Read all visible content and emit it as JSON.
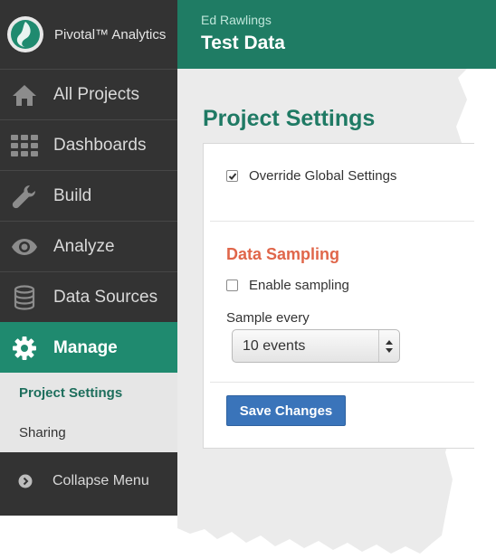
{
  "app": {
    "brand": "Pivotal™ Analytics"
  },
  "sidebar": {
    "items": [
      {
        "label": "All Projects",
        "icon": "home-icon"
      },
      {
        "label": "Dashboards",
        "icon": "grid-icon"
      },
      {
        "label": "Build",
        "icon": "wrench-icon"
      },
      {
        "label": "Analyze",
        "icon": "eye-icon"
      },
      {
        "label": "Data Sources",
        "icon": "database-icon"
      },
      {
        "label": "Manage",
        "icon": "gear-icon",
        "active": true
      }
    ],
    "subitems": [
      {
        "label": "Project Settings",
        "active": true
      },
      {
        "label": "Sharing"
      }
    ],
    "collapse_label": "Collapse Menu"
  },
  "header": {
    "user": "Ed Rawlings",
    "project": "Test Data"
  },
  "main": {
    "title": "Project Settings",
    "override_label": "Override Global Settings",
    "override_checked": true,
    "section_title": "Data Sampling",
    "enable_label": "Enable sampling",
    "enable_checked": false,
    "sample_label": "Sample every",
    "sample_value": "10 events",
    "save_label": "Save Changes"
  },
  "colors": {
    "accent": "#1f8a6f",
    "section": "#e0664a",
    "button": "#3a74ba",
    "sidebar": "#333333"
  }
}
